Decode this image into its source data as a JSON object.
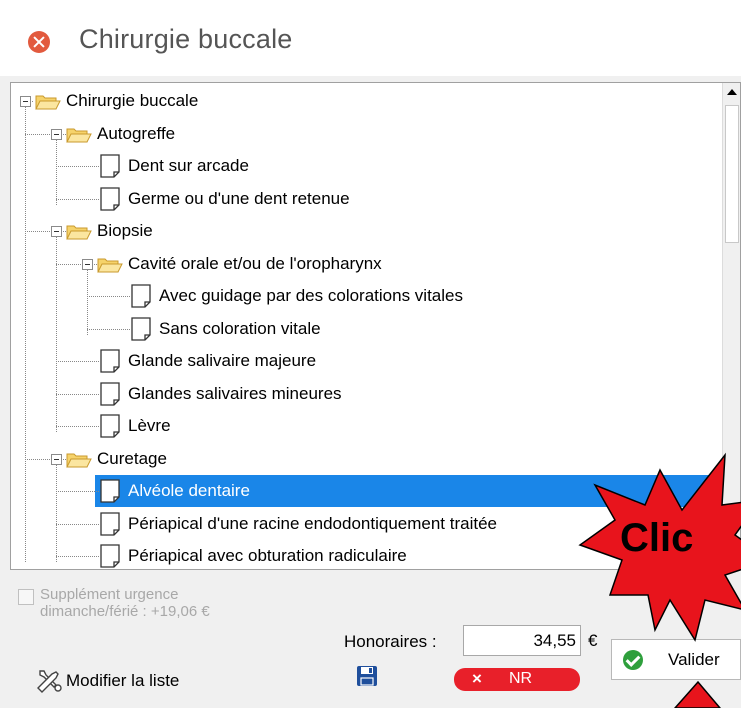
{
  "dialog": {
    "title": "Chirurgie buccale"
  },
  "tree": {
    "nodes": [
      {
        "label": "Chirurgie buccale",
        "type": "folder",
        "level": 0,
        "expanded": true,
        "selected": false
      },
      {
        "label": "Autogreffe",
        "type": "folder",
        "level": 1,
        "expanded": true,
        "selected": false
      },
      {
        "label": "Dent sur arcade",
        "type": "leaf",
        "level": 2,
        "selected": false
      },
      {
        "label": "Germe ou d'une dent retenue",
        "type": "leaf",
        "level": 2,
        "selected": false
      },
      {
        "label": "Biopsie",
        "type": "folder",
        "level": 1,
        "expanded": true,
        "selected": false
      },
      {
        "label": "Cavité orale et/ou de l'oropharynx",
        "type": "folder",
        "level": 2,
        "expanded": true,
        "selected": false
      },
      {
        "label": "Avec guidage par des colorations vitales",
        "type": "leaf",
        "level": 3,
        "selected": false
      },
      {
        "label": "Sans coloration vitale",
        "type": "leaf",
        "level": 3,
        "selected": false
      },
      {
        "label": "Glande salivaire majeure",
        "type": "leaf",
        "level": 2,
        "selected": false
      },
      {
        "label": "Glandes salivaires mineures",
        "type": "leaf",
        "level": 2,
        "selected": false
      },
      {
        "label": "Lèvre",
        "type": "leaf",
        "level": 2,
        "selected": false
      },
      {
        "label": "Curetage",
        "type": "folder",
        "level": 1,
        "expanded": true,
        "selected": false
      },
      {
        "label": "Alvéole dentaire",
        "type": "leaf",
        "level": 2,
        "selected": true
      },
      {
        "label": "Périapical d'une racine endodontiquement traitée",
        "type": "leaf",
        "level": 2,
        "selected": false
      },
      {
        "label": "Périapical avec obturation radiculaire",
        "type": "leaf",
        "level": 2,
        "selected": false
      }
    ]
  },
  "footer": {
    "supplement_line1": "Supplément urgence",
    "supplement_line2": "dimanche/férié : +19,06 €",
    "supplement_checked": false,
    "honoraires_label": "Honoraires :",
    "honoraires_value": "34,55",
    "currency": "€",
    "modify_list_label": "Modifier la liste",
    "nr_icon": "×",
    "nr_label": "NR",
    "validate_label": "Valider"
  },
  "annotation": {
    "callout_text": "Clic",
    "burst_color": "#e8141c"
  },
  "colors": {
    "selection": "#1a86e8",
    "close_icon": "#e25a3e",
    "nr_badge": "#e8202a",
    "validate_icon": "#2e9f3c",
    "folder": "#f6d36b"
  },
  "icons": {
    "close": "close-circle-icon",
    "folder": "open-folder-icon",
    "leaf": "document-icon",
    "modify": "tools-icon",
    "save": "floppy-disk-icon",
    "validate": "check-circle-icon"
  }
}
